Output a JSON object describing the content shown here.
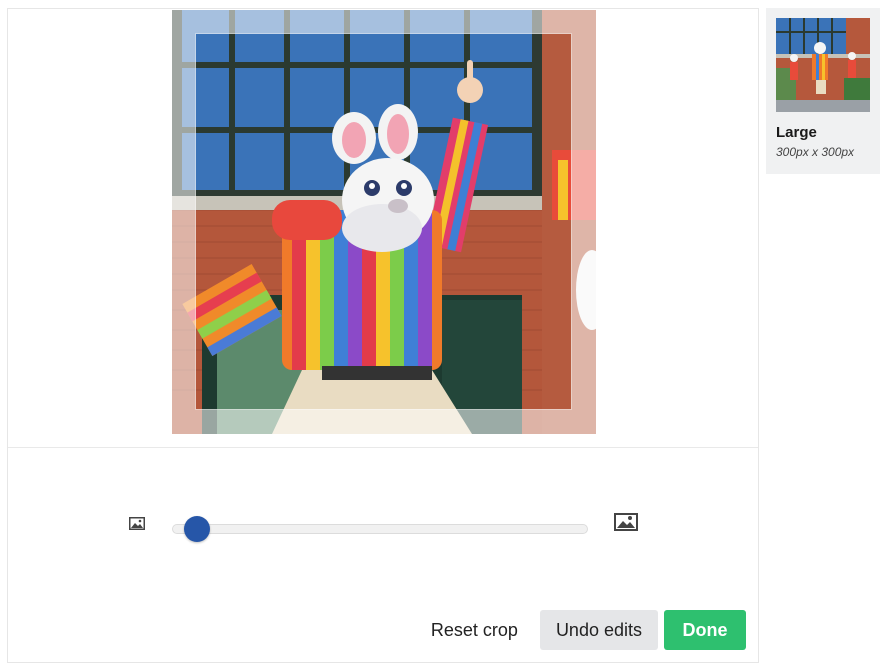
{
  "image": {
    "description_icon": "photo-icon",
    "alt": "Person in bunny costume and rainbow shirt dancing"
  },
  "zoom": {
    "min_icon": "small-image-icon",
    "max_icon": "large-image-icon",
    "value": 0
  },
  "actions": {
    "reset_label": "Reset crop",
    "undo_label": "Undo edits",
    "done_label": "Done"
  },
  "sizes": [
    {
      "name": "Large",
      "dims": "300px x 300px"
    }
  ],
  "colors": {
    "accent": "#2656a8",
    "done": "#2ec06f"
  }
}
